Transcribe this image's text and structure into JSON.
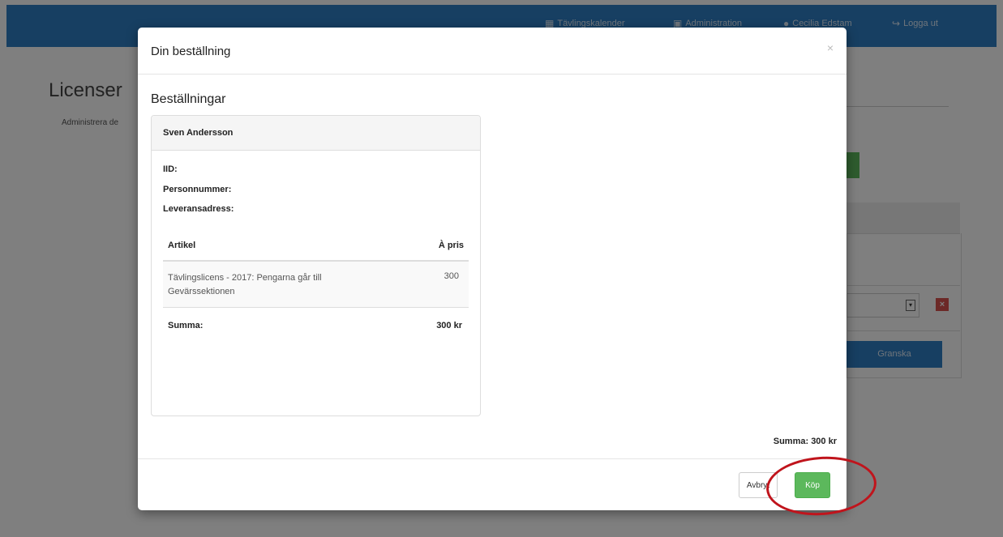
{
  "navbar": {
    "items": [
      {
        "icon": "calendar-icon",
        "label": "Tävlingskalender"
      },
      {
        "icon": "briefcase-icon",
        "label": "Administration"
      },
      {
        "icon": "user-icon",
        "label": "Cecilia Edstam"
      },
      {
        "icon": "logout-icon",
        "label": "Logga ut"
      }
    ]
  },
  "page": {
    "title": "Licenser",
    "subtitle": "Administrera de",
    "granska_label": "Granska"
  },
  "modal": {
    "title": "Din beställning",
    "close": "×",
    "section_title": "Beställningar",
    "order": {
      "name": "Sven Andersson",
      "fields": [
        "IID:",
        "Personnummer:",
        "Leveransadress:"
      ],
      "table": {
        "col_article": "Artikel",
        "col_price": "À pris",
        "rows": [
          {
            "article": "Tävlingslicens - 2017: Pengarna går till Gevärssektionen",
            "price": "300"
          }
        ],
        "sum_label": "Summa:",
        "sum_value": "300 kr"
      }
    },
    "total": "Summa: 300 kr",
    "cancel_label": "Avbryt",
    "buy_label": "Köp"
  },
  "colors": {
    "navbar": "#2f7fc4",
    "buy_button": "#5cb85c",
    "highlight": "#c0141c"
  }
}
